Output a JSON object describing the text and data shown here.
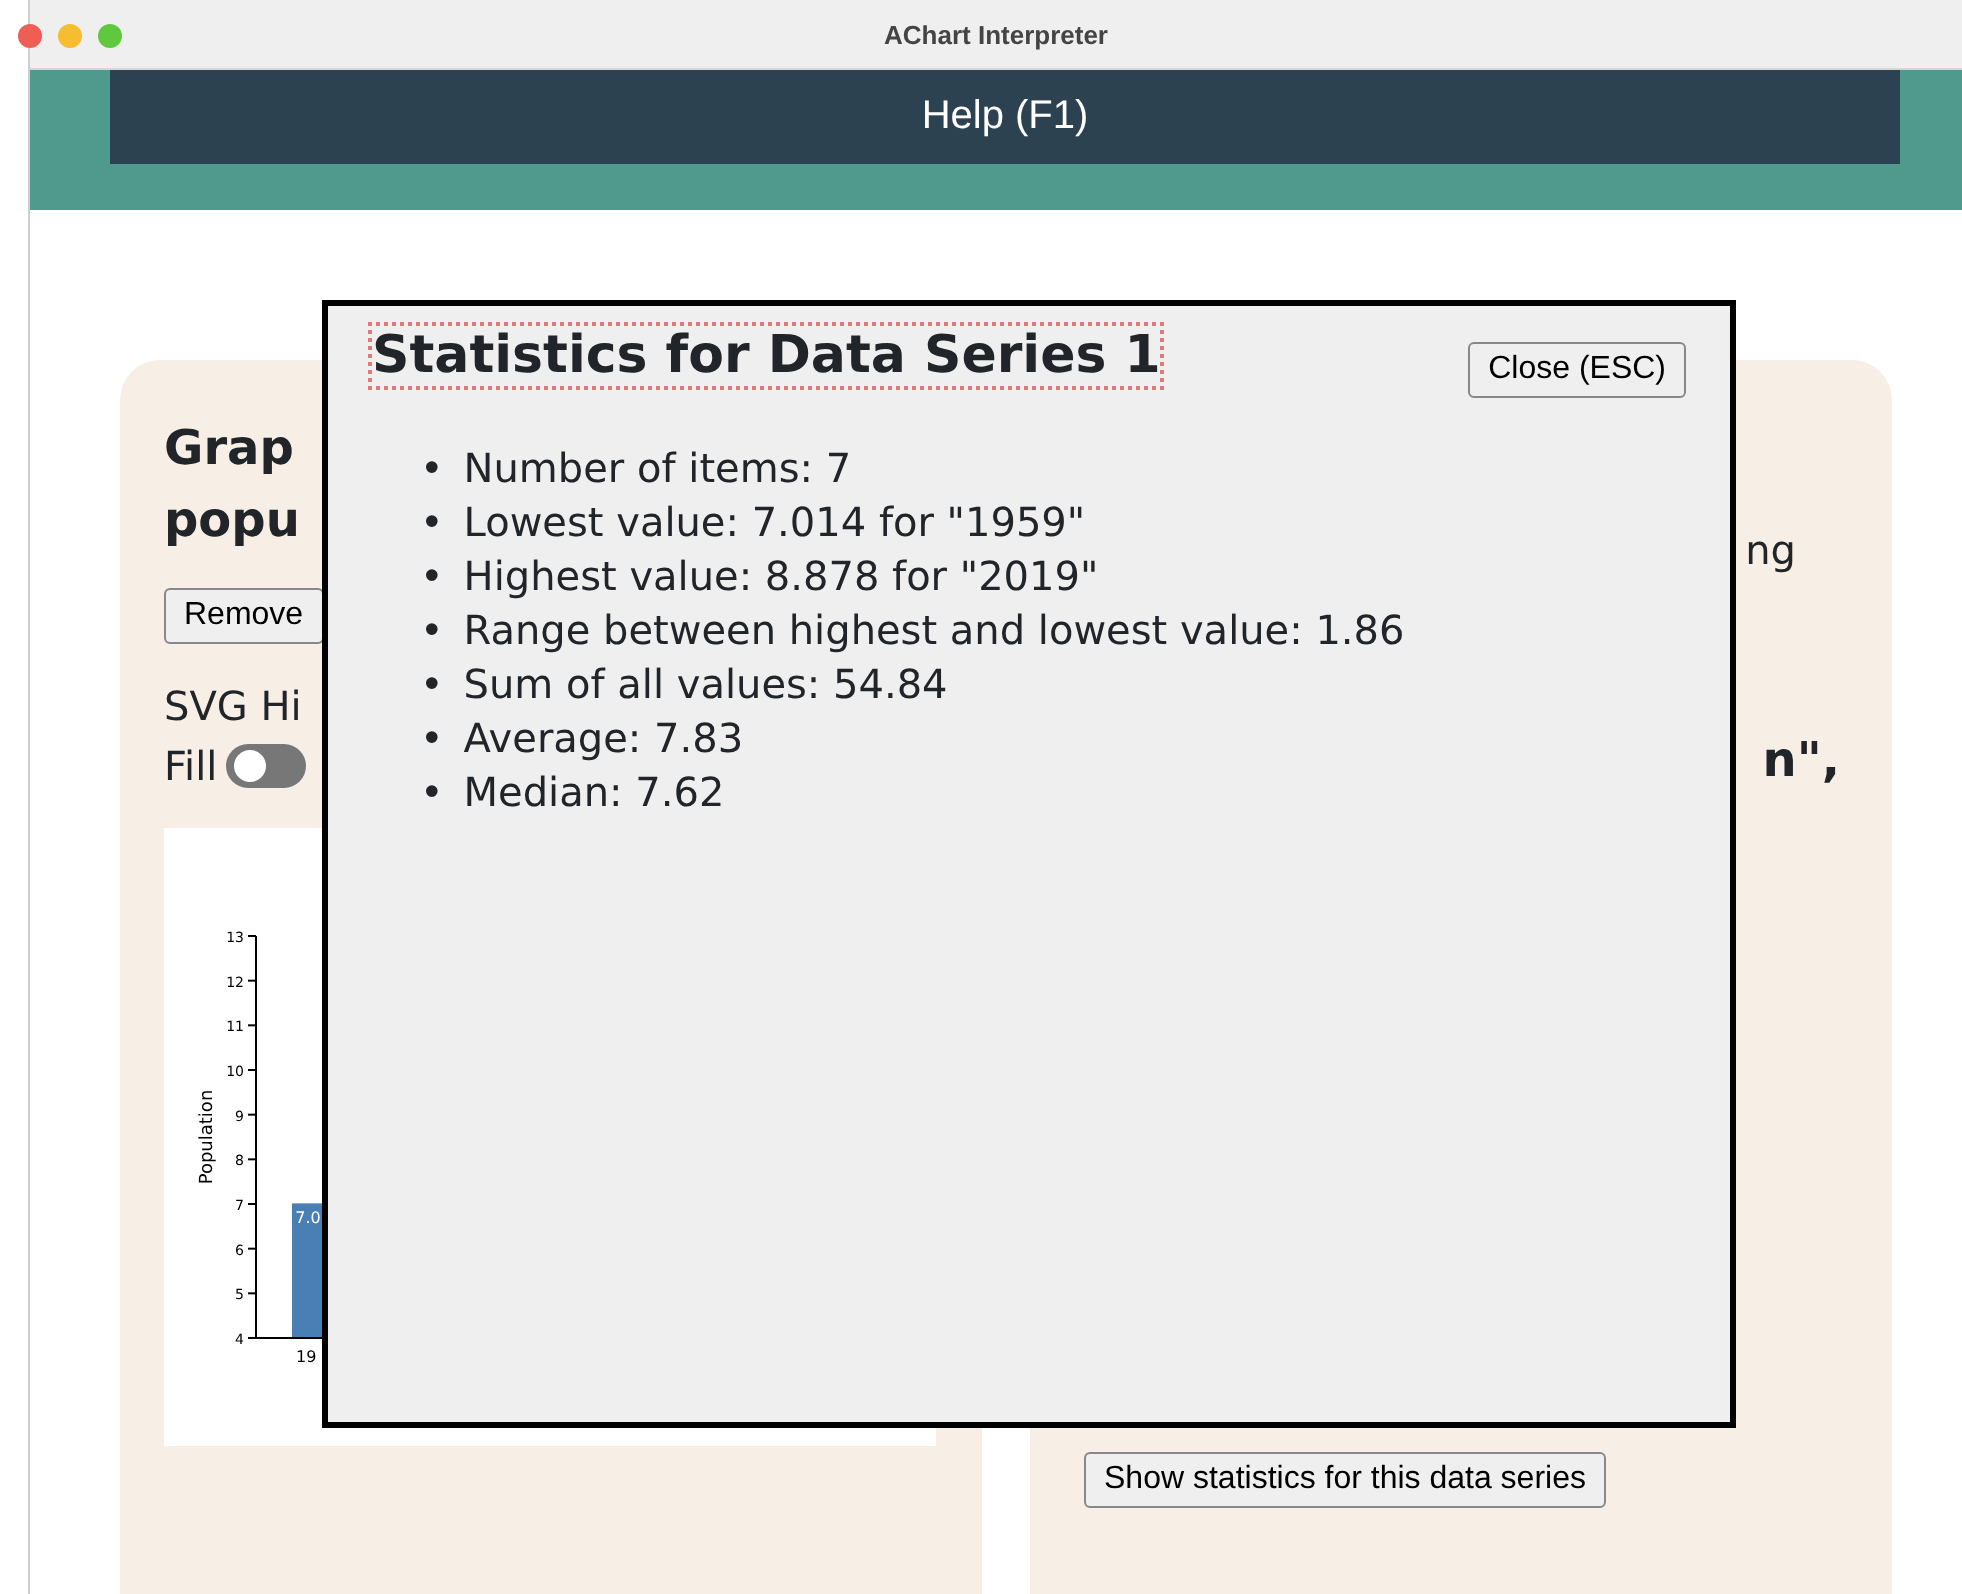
{
  "window": {
    "title": "AChart Interpreter"
  },
  "header": {
    "help_button": "Help (F1)"
  },
  "left_card": {
    "heading_lines": [
      "Grap",
      "popu"
    ],
    "remove_button": "Remove",
    "svg_label": "SVG Hi",
    "fill_toggle": {
      "label": "Fill",
      "on": false
    },
    "chart_data": {
      "type": "bar",
      "ylabel": "Population",
      "categories": [
        "19"
      ],
      "values": [
        7.014
      ],
      "value_labels": [
        "7.0"
      ],
      "ylim": [
        4,
        13
      ],
      "yticks": [
        4,
        5,
        6,
        7,
        8,
        9,
        10,
        11,
        12,
        13
      ]
    }
  },
  "right_card": {
    "text_fragment": "ng",
    "heading_fragment": "n\",",
    "stats_button": "Show statistics for this data series"
  },
  "dialog": {
    "title": "Statistics for Data Series 1",
    "close_button": "Close (ESC)",
    "items": [
      {
        "marker": "•",
        "text": "Number of items: 7"
      },
      {
        "marker": "•",
        "text": "Lowest value: 7.014 for \"1959\""
      },
      {
        "marker": "•",
        "text": "Highest value: 8.878 for \"2019\""
      },
      {
        "marker": "•",
        "text": "Range between highest and lowest value: 1.86"
      },
      {
        "marker": "•",
        "text": "Sum of all values: 54.84"
      },
      {
        "marker": "•",
        "text": "Average: 7.83"
      },
      {
        "marker": "•",
        "text": "Median: 7.62"
      }
    ]
  }
}
